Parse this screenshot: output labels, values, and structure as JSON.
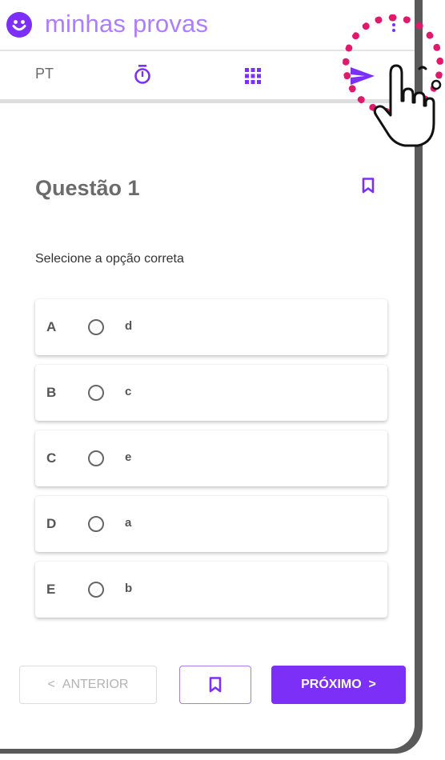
{
  "app": {
    "title": "minhas provas",
    "accent_color": "#7b2ff7",
    "logo_icon": "smiley-logo-icon",
    "menu_icon": "kebab-menu-icon"
  },
  "toolbar": {
    "language": "PT",
    "icons": [
      "timer-icon",
      "grid-icon",
      "send-icon"
    ]
  },
  "question": {
    "title": "Questão 1",
    "instruction": "Selecione a opção correta",
    "options": [
      {
        "letter": "A",
        "text": "d"
      },
      {
        "letter": "B",
        "text": "c"
      },
      {
        "letter": "C",
        "text": "e"
      },
      {
        "letter": "D",
        "text": "a"
      },
      {
        "letter": "E",
        "text": "b"
      }
    ]
  },
  "footer": {
    "prev_label": "ANTERIOR",
    "prev_icon": "chevron-left-icon",
    "next_label": "PRÓXIMO",
    "next_icon": "chevron-right-icon",
    "bookmark_icon": "bookmark-icon"
  },
  "overlay": {
    "highlight_color": "#e0196d",
    "pointer_icon": "hand-pointer-icon"
  }
}
